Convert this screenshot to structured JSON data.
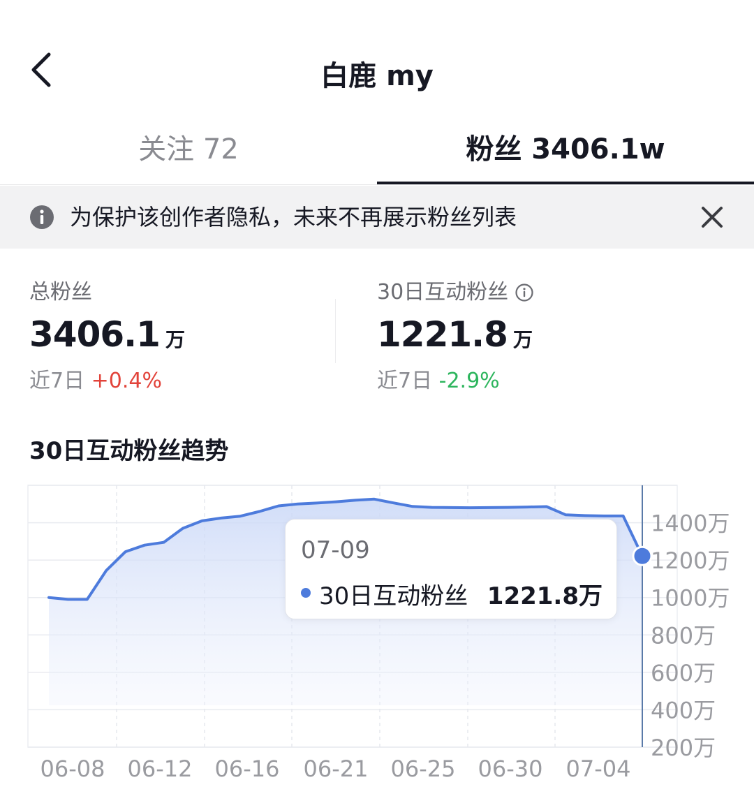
{
  "header": {
    "title": "白鹿 my",
    "back_icon": "chevron-left-icon"
  },
  "tabs": [
    {
      "label": "关注 72",
      "active": false
    },
    {
      "label": "粉丝 3406.1w",
      "active": true
    }
  ],
  "notice": {
    "text": "为保护该创作者隐私，未来不再展示粉丝列表",
    "info_icon": "info-icon",
    "close_icon": "close-icon"
  },
  "stats": {
    "total": {
      "label": "总粉丝",
      "value": "3406.1",
      "unit": "万",
      "change_prefix": "近7日",
      "change": "+0.4%"
    },
    "active": {
      "label": "30日互动粉丝",
      "value": "1221.8",
      "unit": "万",
      "change_prefix": "近7日",
      "change": "-2.9%",
      "info_icon": "info-circle-icon"
    }
  },
  "colors": {
    "up": "#e2433a",
    "down": "#2db55d",
    "line": "#4d7bdc",
    "text": "#161823"
  },
  "chart": {
    "title": "30日互动粉丝趋势",
    "tooltip": {
      "date": "07-09",
      "series": "30日互动粉丝",
      "value": "1221.8万"
    }
  },
  "chart_data": {
    "type": "area",
    "title": "30日互动粉丝趋势",
    "xlabel": "",
    "ylabel": "",
    "x_tick_labels": [
      "06-08",
      "06-12",
      "06-16",
      "06-21",
      "06-25",
      "06-30",
      "07-04"
    ],
    "y_tick_labels": [
      "200万",
      "400万",
      "600万",
      "800万",
      "1000万",
      "1200万",
      "1400万"
    ],
    "ylim": [
      200,
      1600
    ],
    "y_unit": "万",
    "grid": true,
    "series": [
      {
        "values": [
          1000,
          990,
          990,
          1145,
          1245,
          1280,
          1295,
          1370,
          1410,
          1425,
          1435,
          1460,
          1490,
          1500,
          1505,
          1512,
          1520,
          1526,
          1506,
          1487,
          1482,
          1481,
          1480,
          1481,
          1482,
          1484,
          1486,
          1442,
          1438,
          1436,
          1436,
          1221.8
        ]
      }
    ],
    "highlight": {
      "date": "07-09",
      "value": 1221.8
    }
  }
}
